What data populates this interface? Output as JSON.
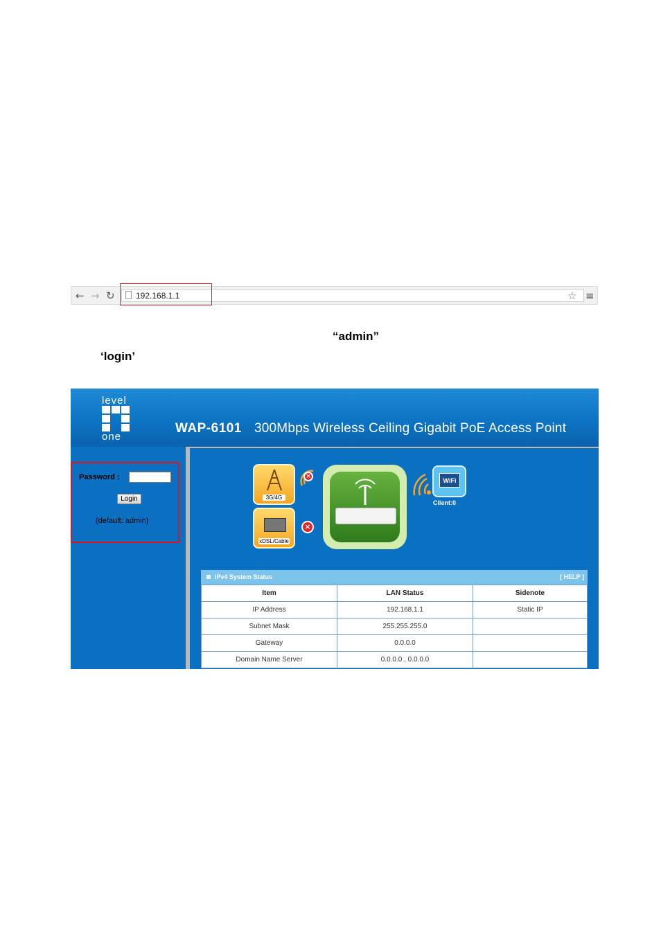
{
  "browser": {
    "url": "192.168.1.1",
    "back_icon": "back-arrow-icon",
    "forward_icon": "forward-arrow-icon",
    "reload_icon": "reload-icon",
    "star_icon": "star-icon",
    "menu_icon": "menu-icon"
  },
  "instructions": {
    "admin_quote": "“admin”",
    "login_quote": "‘login’"
  },
  "screenshot": {
    "logo_top": "level",
    "logo_bottom": "one",
    "product_name": "WAP-6101",
    "product_desc": "300Mbps Wireless Ceiling Gigabit PoE Access Point",
    "password_label": "Password :",
    "password_value": "",
    "login_button": "Login",
    "default_note": "(default: admin)",
    "diagram": {
      "tile1_label": "3G/4G",
      "tile2_label": "xDSL/Cable",
      "wifi_label": "WiFi",
      "client_label": "Client:0"
    },
    "table": {
      "title": "IPv4 System Status",
      "help": "[ HELP ]",
      "headers": [
        "Item",
        "LAN Status",
        "Sidenote"
      ],
      "rows": [
        [
          "IP Address",
          "192.168.1.1",
          "Static IP"
        ],
        [
          "Subnet Mask",
          "255.255.255.0",
          ""
        ],
        [
          "Gateway",
          "0.0.0.0",
          ""
        ],
        [
          "Domain Name Server",
          "0.0.0.0 , 0.0.0.0",
          ""
        ]
      ]
    },
    "colors": {
      "header_blue": "#0d74c4",
      "highlight_red": "#e0141e",
      "table_header": "#7cc4ec"
    }
  }
}
